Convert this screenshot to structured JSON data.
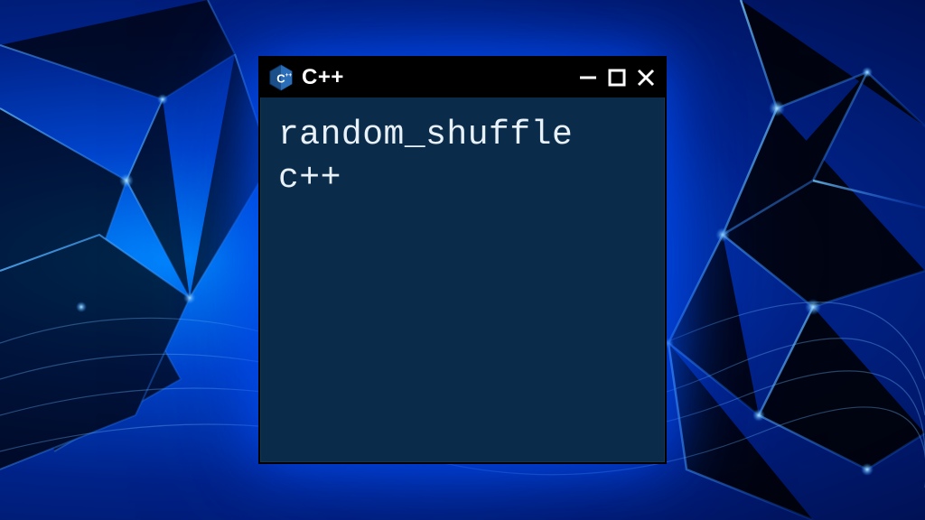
{
  "window": {
    "title": "C++",
    "icon_name": "cpp-icon",
    "controls": {
      "minimize": "minimize",
      "maximize": "maximize",
      "close": "close"
    }
  },
  "content": {
    "line1": "random_shuffle",
    "line2": "c++"
  },
  "colors": {
    "window_bg": "#0a2b4a",
    "titlebar_bg": "#000000",
    "text": "#e8f0f8",
    "accent_glow": "#0066ff"
  }
}
